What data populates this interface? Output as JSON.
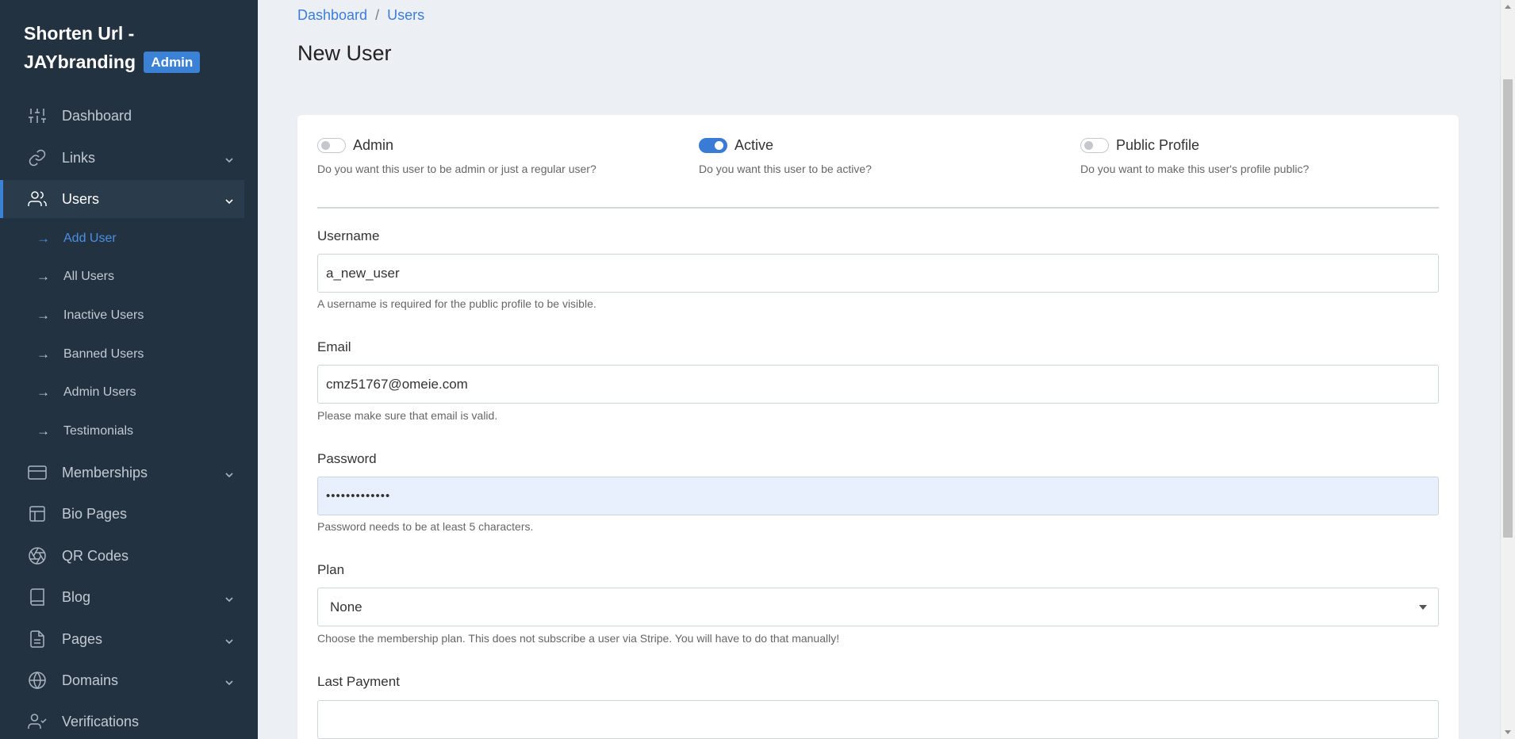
{
  "brand": {
    "title": "Shorten Url - JAYbranding",
    "badge": "Admin"
  },
  "sidebar": {
    "items": [
      {
        "label": "Dashboard",
        "icon": "sliders-icon",
        "has_chevron": false
      },
      {
        "label": "Links",
        "icon": "link-icon",
        "has_chevron": true
      },
      {
        "label": "Users",
        "icon": "users-icon",
        "has_chevron": true,
        "active": true
      },
      {
        "label": "Memberships",
        "icon": "credit-card-icon",
        "has_chevron": true
      },
      {
        "label": "Bio Pages",
        "icon": "layout-icon",
        "has_chevron": false
      },
      {
        "label": "QR Codes",
        "icon": "aperture-icon",
        "has_chevron": false
      },
      {
        "label": "Blog",
        "icon": "book-icon",
        "has_chevron": true
      },
      {
        "label": "Pages",
        "icon": "file-text-icon",
        "has_chevron": true
      },
      {
        "label": "Domains",
        "icon": "globe-icon",
        "has_chevron": true
      },
      {
        "label": "Verifications",
        "icon": "user-check-icon",
        "has_chevron": false
      }
    ],
    "users_submenu": [
      {
        "label": "Add User",
        "current": true
      },
      {
        "label": "All Users"
      },
      {
        "label": "Inactive Users"
      },
      {
        "label": "Banned Users"
      },
      {
        "label": "Admin Users"
      },
      {
        "label": "Testimonials"
      }
    ],
    "arrow_glyph": "→"
  },
  "breadcrumb": {
    "items": [
      "Dashboard",
      "Users"
    ],
    "separator": "/"
  },
  "page_title": "New User",
  "toggles": [
    {
      "label": "Admin",
      "help": "Do you want this user to be admin or just a regular user?",
      "on": false
    },
    {
      "label": "Active",
      "help": "Do you want this user to be active?",
      "on": true
    },
    {
      "label": "Public Profile",
      "help": "Do you want to make this user's profile public?",
      "on": false
    }
  ],
  "form": {
    "username": {
      "label": "Username",
      "value": "a_new_user",
      "help": "A username is required for the public profile to be visible."
    },
    "email": {
      "label": "Email",
      "value": "cmz51767@omeie.com",
      "help": "Please make sure that email is valid."
    },
    "password": {
      "label": "Password",
      "value": "•••••••••••••",
      "help": "Password needs to be at least 5 characters."
    },
    "plan": {
      "label": "Plan",
      "value": "None",
      "help": "Choose the membership plan. This does not subscribe a user via Stripe. You will have to do that manually!"
    },
    "last_payment": {
      "label": "Last Payment",
      "value": ""
    }
  },
  "colors": {
    "sidebar_bg": "#233240",
    "accent": "#3b82d6",
    "page_bg": "#eceff3",
    "autofill_bg": "#e8f0fe"
  }
}
